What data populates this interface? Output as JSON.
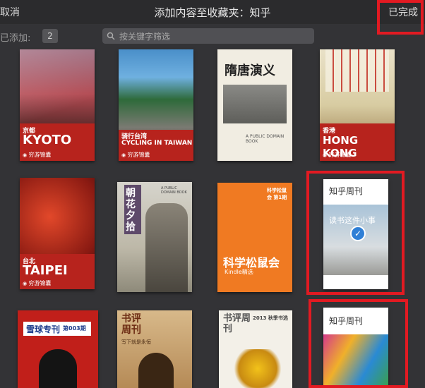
{
  "header": {
    "cancel_label": "取消",
    "title": "添加内容至收藏夹：知乎",
    "done_label": "已完成"
  },
  "toolbar": {
    "added_label": "已添加:",
    "added_count": "2",
    "search_placeholder": "按关键字筛选"
  },
  "books": [
    {
      "city_cn": "京都",
      "city_en": "KYOTO",
      "publisher": "穷游锦囊"
    },
    {
      "title_cn": "骑行台湾",
      "title_en": "CYCLING IN TAIWAN",
      "publisher": "穷游锦囊"
    },
    {
      "title": "隋唐演义",
      "subtitle": "A PUBLIC DOMAIN BOOK"
    },
    {
      "city_cn": "香港",
      "city_en": "HONG KONG",
      "publisher": "穷游锦囊"
    },
    {
      "city_cn": "台北",
      "city_en": "TAIPEI",
      "publisher": "穷游锦囊"
    },
    {
      "title": "朝花夕拾",
      "subtitle": "A PUBLIC DOMAIN BOOK"
    },
    {
      "title": "科学松鼠会",
      "subtitle": "Kindle精选",
      "badge": "科学松鼠会 第1期"
    },
    {
      "magazine": "知乎周刊",
      "headline": "读书这件小事",
      "selected": true
    },
    {
      "title": "雪球专刊",
      "issue": "第003期"
    },
    {
      "magazine": "书评周刊",
      "headline": "写下就是永恒"
    },
    {
      "magazine": "书评周刊",
      "subtitle": "2013 秋季书选"
    },
    {
      "magazine": "知乎周刊"
    }
  ],
  "colors": {
    "highlight": "#e21a22",
    "check": "#2f7fd6",
    "background": "#333336"
  }
}
